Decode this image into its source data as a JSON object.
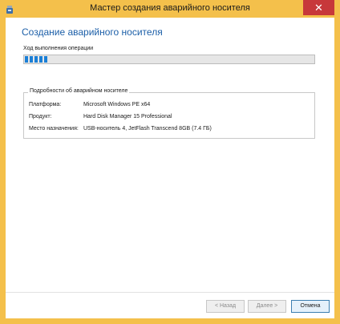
{
  "window": {
    "title": "Мастер создания аварийного носителя",
    "close_glyph": "✕"
  },
  "page": {
    "heading": "Создание аварийного носителя",
    "progress_label": "Ход выполнения операции",
    "progress_fraction": 0.08
  },
  "details": {
    "legend": "Подробности об аварийном носителе",
    "rows": [
      {
        "label": "Платформа:",
        "value": "Microsoft Windows PE x64"
      },
      {
        "label": "Продукт:",
        "value": "Hard Disk Manager 15 Professional"
      },
      {
        "label": "Место назначения:",
        "value": "USB-носитель 4, JetFlash Transcend 8GB (7.4 ГБ)"
      }
    ]
  },
  "buttons": {
    "back": "< Назад",
    "next": "Далее >",
    "cancel": "Отмена"
  },
  "icons": {
    "app": "usb-drive-icon"
  },
  "colors": {
    "accent": "#1b7fd6",
    "frame": "#f4c04b",
    "close": "#c7383a"
  }
}
